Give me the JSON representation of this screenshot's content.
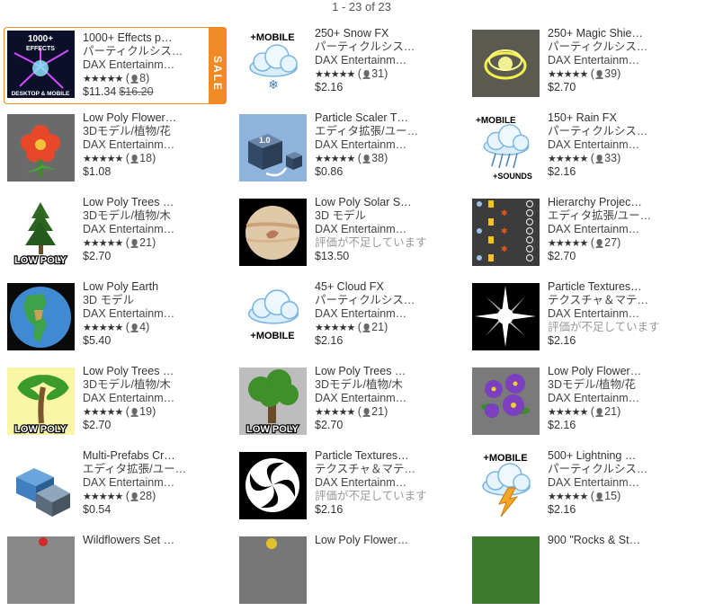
{
  "pager": {
    "text": "1 - 23 of 23"
  },
  "sale_label": "SALE",
  "products": [
    {
      "title": "1000+ Effects p…",
      "category": "パーティクルシス…",
      "publisher": "DAX Entertainm…",
      "stars": "★★★★★",
      "count": "8",
      "price": "$11.34",
      "old_price": "$16.20",
      "thumb": "effects",
      "thumb_text": [
        "1000+",
        "EFFECTS",
        "DESKTOP & MOBILE"
      ]
    },
    {
      "title": "250+ Snow FX",
      "category": "パーティクルシス…",
      "publisher": "DAX Entertainm…",
      "stars": "★★★★★",
      "count": "31",
      "price": "$2.16",
      "thumb": "snow",
      "thumb_text": [
        "+MOBILE"
      ]
    },
    {
      "title": "250+ Magic Shie…",
      "category": "パーティクルシス…",
      "publisher": "DAX Entertainm…",
      "stars": "★★★★★",
      "count": "39",
      "price": "$2.70",
      "thumb": "magic"
    },
    {
      "title": "Low Poly Flower…",
      "category": "3Dモデル/植物/花",
      "publisher": "DAX Entertainm…",
      "stars": "★★★★★",
      "count": "18",
      "price": "$1.08",
      "thumb": "flower"
    },
    {
      "title": "Particle Scaler T…",
      "category": "エディタ拡張/ユー…",
      "publisher": "DAX Entertainm…",
      "stars": "★★★★★",
      "count": "38",
      "price": "$0.86",
      "thumb": "scaler",
      "thumb_text": [
        "1.0"
      ]
    },
    {
      "title": "150+ Rain FX",
      "category": "パーティクルシス…",
      "publisher": "DAX Entertainm…",
      "stars": "★★★★★",
      "count": "33",
      "price": "$2.16",
      "thumb": "rain",
      "thumb_text": [
        "+MOBILE",
        "+SOUNDS"
      ]
    },
    {
      "title": "Low Poly Trees …",
      "category": "3Dモデル/植物/木",
      "publisher": "DAX Entertainm…",
      "stars": "★★★★★",
      "count": "21",
      "price": "$2.70",
      "thumb": "pine",
      "thumb_text": [
        "LOW POLY"
      ]
    },
    {
      "title": "Low Poly Solar S…",
      "category": "3D モデル",
      "publisher": "DAX Entertainm…",
      "noreview": "評価が不足しています",
      "price": "$13.50",
      "thumb": "planet"
    },
    {
      "title": "Hierarchy Projec…",
      "category": "エディタ拡張/ユー…",
      "publisher": "DAX Entertainm…",
      "stars": "★★★★★",
      "count": "27",
      "price": "$2.70",
      "thumb": "hierarchy"
    },
    {
      "title": "Low Poly Earth",
      "category": "3D モデル",
      "publisher": "DAX Entertainm…",
      "stars": "★★★★★",
      "count": "4",
      "price": "$5.40",
      "thumb": "earth"
    },
    {
      "title": "45+ Cloud FX",
      "category": "パーティクルシス…",
      "publisher": "DAX Entertainm…",
      "stars": "★★★★★",
      "count": "21",
      "price": "$2.16",
      "thumb": "cloud",
      "thumb_text": [
        "+MOBILE"
      ]
    },
    {
      "title": "Particle Textures…",
      "category": "テクスチャ＆マテ…",
      "publisher": "DAX Entertainm…",
      "noreview": "評価が不足しています",
      "price": "$2.16",
      "thumb": "flare"
    },
    {
      "title": "Low Poly Trees …",
      "category": "3Dモデル/植物/木",
      "publisher": "DAX Entertainm…",
      "stars": "★★★★★",
      "count": "19",
      "price": "$2.70",
      "thumb": "palm",
      "thumb_text": [
        "LOW POLY"
      ]
    },
    {
      "title": "Low Poly Trees …",
      "category": "3Dモデル/植物/木",
      "publisher": "DAX Entertainm…",
      "stars": "★★★★★",
      "count": "21",
      "price": "$2.70",
      "thumb": "oak",
      "thumb_text": [
        "LOW POLY"
      ]
    },
    {
      "title": "Low Poly Flower…",
      "category": "3Dモデル/植物/花",
      "publisher": "DAX Entertainm…",
      "stars": "★★★★★",
      "count": "21",
      "price": "$2.16",
      "thumb": "violet"
    },
    {
      "title": "Multi-Prefabs Cr…",
      "category": "エディタ拡張/ユー…",
      "publisher": "DAX Entertainm…",
      "stars": "★★★★★",
      "count": "28",
      "price": "$0.54",
      "thumb": "cubes"
    },
    {
      "title": "Particle Textures…",
      "category": "テクスチャ＆マテ…",
      "publisher": "DAX Entertainm…",
      "noreview": "評価が不足しています",
      "price": "$2.16",
      "thumb": "swirl"
    },
    {
      "title": "500+ Lightning …",
      "category": "パーティクルシス…",
      "publisher": "DAX Entertainm…",
      "stars": "★★★★★",
      "count": "15",
      "price": "$2.16",
      "thumb": "lightning",
      "thumb_text": [
        "+MOBILE"
      ]
    },
    {
      "title": "Wildflowers Set …",
      "thumb": "wild"
    },
    {
      "title": "Low Poly Flower…",
      "thumb": "yellow"
    },
    {
      "title": "900 \"Rocks & St…",
      "thumb": "rocks"
    }
  ]
}
